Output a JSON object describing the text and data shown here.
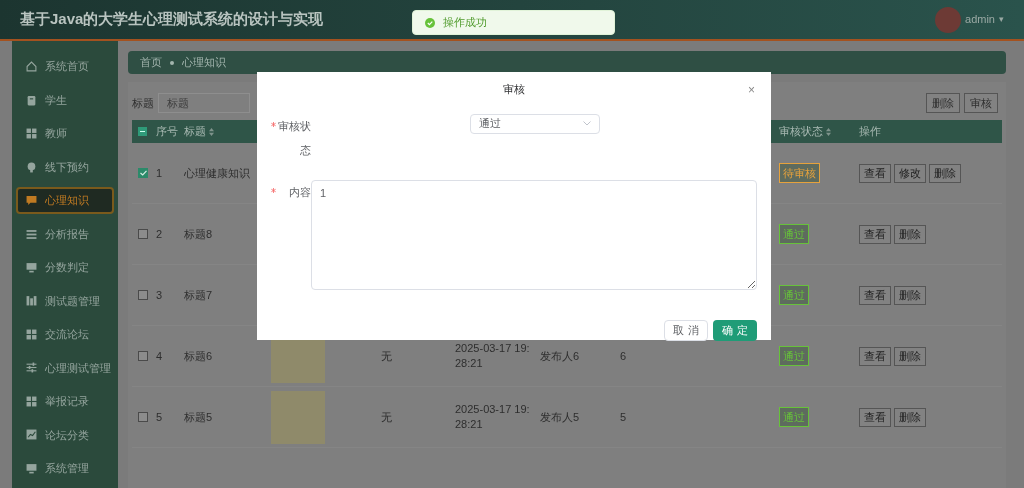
{
  "header": {
    "title": "基于Java的大学生心理测试系统的设计与实现",
    "user": "admin",
    "menu_caret": "▾"
  },
  "toast": {
    "message": "操作成功"
  },
  "sidebar": {
    "items": [
      {
        "label": "系统首页",
        "selected": false
      },
      {
        "label": "学生",
        "selected": false
      },
      {
        "label": "教师",
        "selected": false
      },
      {
        "label": "线下预约",
        "selected": false
      },
      {
        "label": "心理知识",
        "selected": true
      },
      {
        "label": "分析报告",
        "selected": false
      },
      {
        "label": "分数判定",
        "selected": false
      },
      {
        "label": "测试题管理",
        "selected": false
      },
      {
        "label": "交流论坛",
        "selected": false
      },
      {
        "label": "心理测试管理",
        "selected": false
      },
      {
        "label": "举报记录",
        "selected": false
      },
      {
        "label": "论坛分类",
        "selected": false
      },
      {
        "label": "系统管理",
        "selected": false
      }
    ]
  },
  "breadcrumb": [
    "首页",
    "心理知识"
  ],
  "search": {
    "label": "标题",
    "placeholder": "标题"
  },
  "toolbar_buttons": [
    "删除",
    "审核"
  ],
  "table": {
    "select_all_indeterminate": true,
    "columns": [
      {
        "label": "序号",
        "sortable": false
      },
      {
        "label": "标题",
        "sortable": true
      },
      {
        "label": "审核状态",
        "sortable": true
      },
      {
        "label": "操作",
        "sortable": false
      }
    ],
    "rows": [
      {
        "checked": true,
        "index": "1",
        "title": "心理健康知识",
        "status": "待审核",
        "color": "#e6a23c",
        "actions": [
          "查看",
          "修改",
          "删除"
        ]
      },
      {
        "checked": false,
        "index": "2",
        "title": "标题8",
        "status": "通过",
        "color": "#67c23a",
        "actions": [
          "查看",
          "删除"
        ]
      },
      {
        "checked": false,
        "index": "3",
        "title": "标题7",
        "status": "通过",
        "color": "#67c23a",
        "actions": [
          "查看",
          "删除"
        ]
      },
      {
        "checked": false,
        "index": "4",
        "title": "标题6",
        "has_image": true,
        "column_5": "无",
        "date": "2025-03-17 19:28:21",
        "publisher": "发布人6",
        "column_8": "6",
        "status": "通过",
        "color": "#67c23a",
        "actions": [
          "查看",
          "删除"
        ]
      },
      {
        "checked": false,
        "index": "5",
        "title": "标题5",
        "has_image": true,
        "column_5": "无",
        "date": "2025-03-17 19:28:21",
        "publisher": "发布人5",
        "column_8": "5",
        "status": "通过",
        "color": "#67c23a",
        "actions": [
          "查看",
          "删除"
        ]
      }
    ]
  },
  "dialog": {
    "title": "审核",
    "close": "×",
    "fields": [
      {
        "kind": "select",
        "label": "审核状态",
        "value": "通过",
        "required": true
      },
      {
        "kind": "textarea",
        "label": "内容",
        "value": "1",
        "required": true
      }
    ],
    "buttons": [
      {
        "label": "取 消",
        "primary": false
      },
      {
        "label": "确 定",
        "primary": true
      }
    ]
  }
}
